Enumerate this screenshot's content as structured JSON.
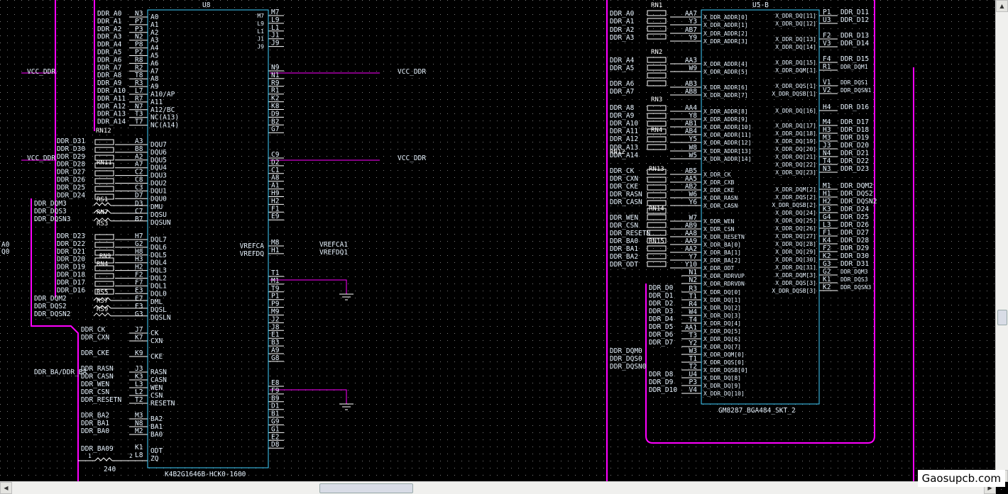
{
  "colors": {
    "background": "#000000",
    "wire": "#ff00ff",
    "body": "#3fd0ff",
    "text": "#e8f4ff",
    "grid": "#7a7a7a"
  },
  "icons": [
    "scroll-up-icon",
    "scroll-down-icon",
    "scroll-left-icon",
    "scroll-right-icon",
    "ground-icon",
    "resistor-icon"
  ],
  "edge_labels": [
    "A0",
    "Q0"
  ],
  "watermark": "Gaosupcb.com",
  "u8": {
    "title": "U8",
    "part": "K4B2G1646B-HCK0-1600",
    "left_nets": [
      "DDR_A0",
      "DDR_A1",
      "DDR_A2",
      "DDR_A3",
      "DDR_A4",
      "DDR_A5",
      "DDR_A6",
      "DDR_A7",
      "DDR_A8",
      "DDR_A9",
      "DDR_A10",
      "DDR_A11",
      "DDR_A12",
      "DDR_A13",
      "DDR_A14"
    ],
    "left_pins": [
      "N3",
      "P7",
      "P3",
      "N2",
      "P8",
      "P2",
      "R8",
      "R2",
      "T8",
      "R3",
      "L7",
      "R7",
      "N7",
      "T3",
      "T7"
    ],
    "left_names": [
      "A0",
      "A1",
      "A2",
      "A3",
      "A4",
      "A5",
      "A6",
      "A7",
      "A8",
      "A9",
      "A10/AP",
      "A11",
      "A12/BC",
      "NC(A13)",
      "NC(A14)"
    ],
    "dq_upper_nets": [
      "DDR_D31",
      "DDR_D30",
      "DDR_D29",
      "DDR_D28",
      "DDR_D27",
      "DDR_D26",
      "DDR_D25",
      "DDR_D24"
    ],
    "dq_upper_pins": [
      "A3",
      "B8",
      "A2",
      "A7",
      "C2",
      "C8",
      "C3",
      "D7"
    ],
    "dq_upper_names": [
      "DQU7",
      "DQU6",
      "DQU5",
      "DQU4",
      "DQU3",
      "DQU2",
      "DQU1",
      "DQU0"
    ],
    "dmu_nets": [
      "DDR_DQM3",
      "DDR_DQS3",
      "DDR_DQSN3"
    ],
    "dmu_pins": [
      "D3",
      "C7",
      "B7"
    ],
    "dmu_names": [
      "DMU",
      "DQSU",
      "DQSUN"
    ],
    "dq_lower_nets": [
      "DDR_D23",
      "DDR_D22",
      "DDR_D21",
      "DDR_D20",
      "DDR_D19",
      "DDR_D18",
      "DDR_D17",
      "DDR_D16"
    ],
    "dq_lower_pins": [
      "H7",
      "G2",
      "H8",
      "H3",
      "H2",
      "F2",
      "F7",
      "E3"
    ],
    "dq_lower_names": [
      "DQL7",
      "DQL6",
      "DQL5",
      "DQL4",
      "DQL3",
      "DQL2",
      "DQL1",
      "DQL0"
    ],
    "dml_nets": [
      "DDR_DQM2",
      "DDR_DQS2",
      "DDR_DQSN2"
    ],
    "dml_pins": [
      "E7",
      "F3",
      "G3"
    ],
    "dml_names": [
      "DML",
      "DQSL",
      "DQSLN"
    ],
    "ctrl_nets": [
      "DDR_CK",
      "DDR_CXN",
      "DDR_CKE",
      "DDR_RASN",
      "DDR_CASN",
      "DDR_WEN",
      "DDR_CSN",
      "DDR_RESETN",
      "DDR_BA2",
      "DDR_BA1",
      "DDR_BA0"
    ],
    "ctrl_pins": [
      "J7",
      "K7",
      "K9",
      "J3",
      "K3",
      "L3",
      "L2",
      "T2",
      "M3",
      "N8",
      "M2"
    ],
    "ctrl_names": [
      "CK",
      "CXN",
      "CKE",
      "RASN",
      "CASN",
      "WEN",
      "CSN",
      "RESETN",
      "BA2",
      "BA1",
      "BA0"
    ],
    "odt": {
      "net": "DDR_BA09",
      "pins": [
        "K1",
        "L8"
      ],
      "names": [
        "ODT",
        "ZQ"
      ],
      "resistor": "240",
      "pin_a": "1",
      "pin_b": "2"
    },
    "ba_note": "DDR_BA/DDR_BA",
    "resistor_refs": [
      "RN12",
      "RN11",
      "RS1",
      "RN7",
      "RS3",
      "RN4",
      "RN9",
      "RS5",
      "RS7",
      "RS9"
    ],
    "nc_pins": [
      "M7",
      "L9",
      "L1",
      "J1",
      "J9"
    ],
    "vdd_pins": [
      "N9",
      "N1",
      "R9",
      "R1",
      "K2",
      "K8",
      "D9",
      "B2",
      "G7"
    ],
    "vddq_pins": [
      "C9",
      "D2",
      "C1",
      "A8",
      "A1",
      "H9",
      "H2",
      "F1",
      "E9"
    ],
    "vref_pins": [
      "M8",
      "H1"
    ],
    "vref_names": [
      "VREFCA",
      "VREFDQ"
    ],
    "vref_nets": [
      "VREFCA1",
      "VREFDQ1"
    ],
    "vss_pins": [
      "T1",
      "M1",
      "T9",
      "P1",
      "P9",
      "M9",
      "J2",
      "J8",
      "E1",
      "B3",
      "A9",
      "G8"
    ],
    "vssq_pins": [
      "E8",
      "F9",
      "B9",
      "D1",
      "B1",
      "G9",
      "G1",
      "E2",
      "D8"
    ],
    "power_nets": [
      "VCC_DDR",
      "VCC_DDR",
      "VCC_DDR",
      "VCC_DDR"
    ]
  },
  "u5": {
    "title": "U5-B",
    "part": "GM8287_BGA484_SKT_2",
    "rn_labels": [
      "RN1",
      "RN2",
      "RN3",
      "RN4",
      "RN13",
      "RN14",
      "RN15",
      "RN12"
    ],
    "left_nets": [
      "DDR_A0",
      "DDR_A1",
      "DDR_A2",
      "DDR_A3",
      "DDR_A4",
      "DDR_A5",
      "DDR_A6",
      "DDR_A7",
      "DDR_A8",
      "DDR_A9",
      "DDR_A10",
      "DDR_A11",
      "DDR_A12",
      "DDR_A13",
      "DDR_A14",
      "DDR_CK",
      "DDR_CXN",
      "DDR_CKE",
      "DDR_RASN",
      "DDR_CASN",
      "DDR_WEN",
      "DDR_CSN",
      "DDR_RESETN",
      "DDR_BA0",
      "DDR_BA1",
      "DDR_BA2",
      "DDR_ODT"
    ],
    "left_pins": [
      "AA7",
      "Y3",
      "AB7",
      "Y9",
      "AA3",
      "W9",
      "AB3",
      "AB8",
      "AA4",
      "Y8",
      "AB1",
      "AB4",
      "Y5",
      "W8",
      "W5",
      "AB5",
      "AA5",
      "AB2",
      "W6",
      "Y6",
      "W7",
      "AB9",
      "AA8",
      "AA9",
      "AA2",
      "Y7",
      "Y10"
    ],
    "left_names": [
      "X_DDR_ADDR[0]",
      "X_DDR_ADDR[1]",
      "X_DDR_ADDR[2]",
      "X_DDR_ADDR[3]",
      "X_DDR_ADDR[4]",
      "X_DDR_ADDR[5]",
      "X_DDR_ADDR[6]",
      "X_DDR_ADDR[7]",
      "X_DDR_ADDR[8]",
      "X_DDR_ADDR[9]",
      "X_DDR_ADDR[10]",
      "X_DDR_ADDR[11]",
      "X_DDR_ADDR[12]",
      "X_DDR_ADDR[13]",
      "X_DDR_ADDR[14]",
      "X_DDR_CK",
      "X_DDR_CXB",
      "X_DDR_CKE",
      "X_DDR_RASN",
      "X_DDR_CASN",
      "X_DDR_WEN",
      "X_DDR_CSN",
      "X_DDR_RESETN",
      "X_DDR_BA[0]",
      "X_DDR_BA[1]",
      "X_DDR_BA[2]",
      "X_DDR_ODT"
    ],
    "low_nets": [
      "DDR_D0",
      "DDR_D1",
      "DDR_D2",
      "DDR_D3",
      "DDR_D4",
      "DDR_D5",
      "DDR_D6",
      "DDR_D7",
      "DDR_DQM0",
      "DDR_DQS0",
      "DDR_DQSN0",
      "DDR_D8",
      "DDR_D9",
      "DDR_D10"
    ],
    "low_pins": [
      "N1",
      "N2",
      "R3",
      "T1",
      "R4",
      "W4",
      "T4",
      "AA1",
      "T3",
      "Y2",
      "W3",
      "T1",
      "T2",
      "U4",
      "P3",
      "V4"
    ],
    "low_names": [
      "X_DDR_RDRVUP",
      "X_DDR_RDRVDN",
      "X_DDR_DQ[0]",
      "X_DDR_DQ[1]",
      "X_DDR_DQ[2]",
      "X_DDR_DQ[3]",
      "X_DDR_DQ[4]",
      "X_DDR_DQ[5]",
      "X_DDR_DQ[6]",
      "X_DDR_DQ[7]",
      "X_DDR_DQM[0]",
      "X_DDR_DQS[0]",
      "X_DDR_DQSB[0]",
      "X_DDR_DQ[8]",
      "X_DDR_DQ[9]",
      "X_DDR_DQ[10]"
    ],
    "right_pins": [
      "P1",
      "U3",
      "F2",
      "V3",
      "F4",
      "R1",
      "V1",
      "V2",
      "H4",
      "M4",
      "H3",
      "M3",
      "J3",
      "N4",
      "T4",
      "N3",
      "M1",
      "H1",
      "H2",
      "K3",
      "G4",
      "L3",
      "F1",
      "K4",
      "F2",
      "K2",
      "G3",
      "G2",
      "K1",
      "K2"
    ],
    "right_names": [
      "X_DDR_DQ[11]",
      "X_DDR_DQ[12]",
      "X_DDR_DQ[13]",
      "X_DDR_DQ[14]",
      "X_DDR_DQ[15]",
      "X_DDR_DQM[1]",
      "X_DDR_DQS[1]",
      "X_DDR_DQSB[1]",
      "X_DDR_DQ[16]",
      "X_DDR_DQ[17]",
      "X_DDR_DQ[18]",
      "X_DDR_DQ[19]",
      "X_DDR_DQ[20]",
      "X_DDR_DQ[21]",
      "X_DDR_DQ[22]",
      "X_DDR_DQ[23]",
      "X_DDR_DQM[2]",
      "X_DDR_DQS[2]",
      "X_DDR_DQSB[2]",
      "X_DDR_DQ[24]",
      "X_DDR_DQ[25]",
      "X_DDR_DQ[26]",
      "X_DDR_DQ[27]",
      "X_DDR_DQ[28]",
      "X_DDR_DQ[29]",
      "X_DDR_DQ[30]",
      "X_DDR_DQ[31]",
      "X_DDR_DQM[3]",
      "X_DDR_DQS[3]",
      "X_DDR_DQSB[3]"
    ],
    "right_nets": [
      "DDR_D11",
      "DDR_D12",
      "DDR_D13",
      "DDR_D14",
      "DDR_D15",
      "DDR_DQM1",
      "DDR_DQS1",
      "DDR_DQSN1",
      "DDR_D16",
      "DDR_D17",
      "DDR_D18",
      "DDR_D19",
      "DDR_D20",
      "DDR_D21",
      "DDR_D22",
      "DDR_D23",
      "DDR_DQM2",
      "DDR_DQS2",
      "DDR_DQSN2",
      "DDR_D24",
      "DDR_D25",
      "DDR_D26",
      "DDR_D27",
      "DDR_D28",
      "DDR_D29",
      "DDR_D30",
      "DDR_D31",
      "DDR_DQM3",
      "DDR_DQS3",
      "DDR_DQSN3"
    ]
  }
}
